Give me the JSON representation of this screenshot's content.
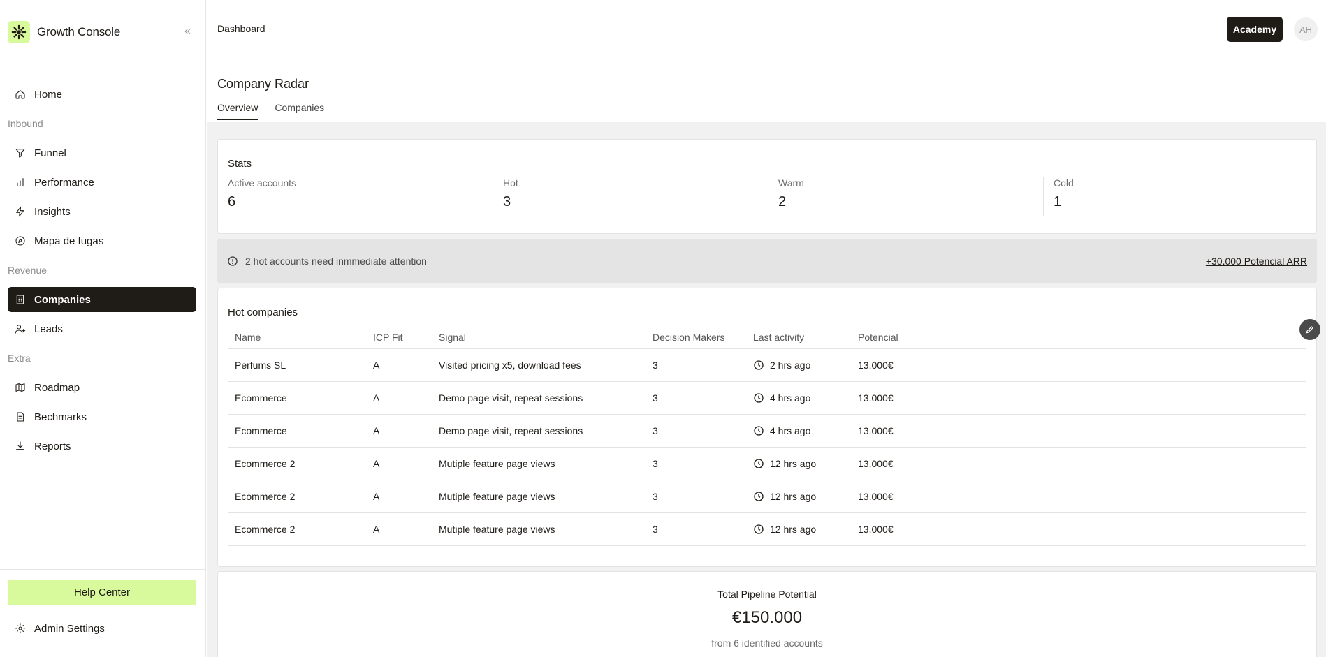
{
  "app": {
    "name": "Growth Console",
    "collapse_glyph": "«"
  },
  "colors": {
    "accent": "#d9f99d",
    "dark": "#1f1b16"
  },
  "sidebar": {
    "home": "Home",
    "section_inbound": "Inbound",
    "funnel": "Funnel",
    "performance": "Performance",
    "insights": "Insights",
    "mapa": "Mapa de fugas",
    "section_revenue": "Revenue",
    "companies": "Companies",
    "leads": "Leads",
    "section_extra": "Extra",
    "roadmap": "Roadmap",
    "bechmarks": "Bechmarks",
    "reports": "Reports",
    "help": "Help Center",
    "admin": "Admin Settings"
  },
  "header": {
    "breadcrumb": "Dashboard",
    "academy": "Academy",
    "avatar": "AH"
  },
  "page": {
    "title": "Company Radar",
    "tabs": [
      "Overview",
      "Companies"
    ]
  },
  "stats": {
    "title": "Stats",
    "items": [
      {
        "label": "Active accounts",
        "value": "6"
      },
      {
        "label": "Hot",
        "value": "3"
      },
      {
        "label": "Warm",
        "value": "2"
      },
      {
        "label": "Cold",
        "value": "1"
      }
    ]
  },
  "alert": {
    "text": "2 hot accounts need inmmediate attention",
    "link": "+30.000 Potencial ARR"
  },
  "hot": {
    "title": "Hot companies",
    "columns": [
      "Name",
      "ICP Fit",
      "Signal",
      "Decision Makers",
      "Last activity",
      "Potencial"
    ],
    "rows": [
      [
        "Perfums SL",
        "A",
        "Visited pricing x5, download fees",
        "3",
        "2 hrs ago",
        "13.000€"
      ],
      [
        "Ecommerce",
        "A",
        "Demo page visit, repeat sessions",
        "3",
        "4 hrs ago",
        "13.000€"
      ],
      [
        "Ecommerce",
        "A",
        "Demo page visit, repeat sessions",
        "3",
        "4 hrs ago",
        "13.000€"
      ],
      [
        "Ecommerce 2",
        "A",
        "Mutiple feature page views",
        "3",
        "12 hrs ago",
        "13.000€"
      ],
      [
        "Ecommerce 2",
        "A",
        "Mutiple feature page views",
        "3",
        "12 hrs ago",
        "13.000€"
      ],
      [
        "Ecommerce 2",
        "A",
        "Mutiple feature page views",
        "3",
        "12 hrs ago",
        "13.000€"
      ]
    ]
  },
  "pipeline": {
    "label": "Total Pipeline Potential",
    "value": "€150.000",
    "sub": "from 6 identified accounts"
  }
}
